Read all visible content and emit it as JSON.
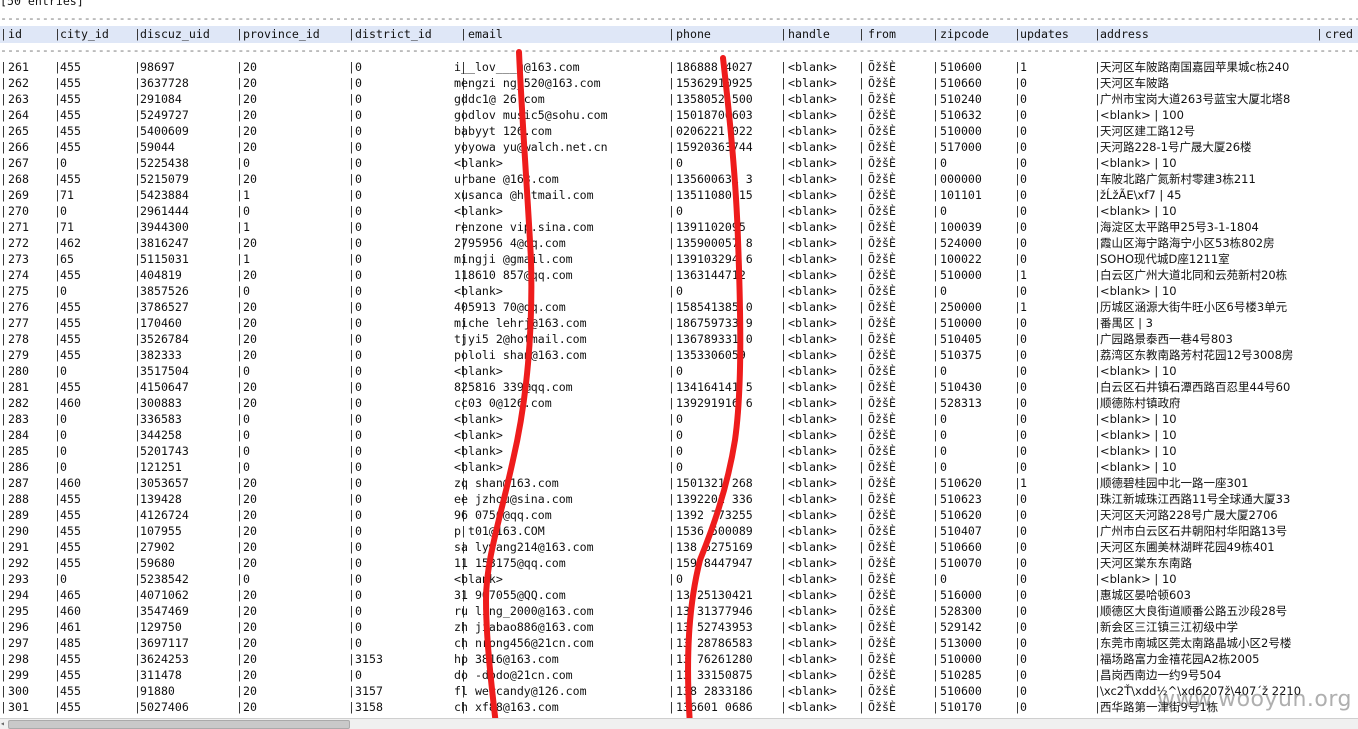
{
  "top_line": "[50 entries]",
  "columns": [
    "id",
    "city_id",
    "discuz_uid",
    "province_id",
    "district_id",
    "email",
    "phone",
    "handle",
    "from",
    "zipcode",
    "updates",
    "address",
    "cred"
  ],
  "rows": [
    [
      "261",
      "455",
      "98697",
      "20",
      "0",
      "i__lov___u@163.com",
      "186888 4027",
      "<blank>",
      "ÕžšÈ",
      "510600",
      "1",
      "天河区车陂路南国嘉园苹果城c栋240"
    ],
    [
      "262",
      "455",
      "3637728",
      "20",
      "0",
      "mengzi ng_520@163.com",
      "15362910925",
      "<blank>",
      "ÕžšÈ",
      "510660",
      "0",
      "天河区车陂路"
    ],
    [
      "263",
      "455",
      "291084",
      "20",
      "0",
      "gddc1@ 26.com",
      "1358052 500",
      "<blank>",
      "ÕžšÈ",
      "510240",
      "0",
      "广州市宝岗大道263号蓝宝大厦北塔8"
    ],
    [
      "264",
      "455",
      "5249727",
      "20",
      "0",
      "godlov music5@sohu.com",
      "15018700603",
      "<blank>",
      "ÕžšÈ",
      "510632",
      "0",
      "<blank>                     | 100"
    ],
    [
      "265",
      "455",
      "5400609",
      "20",
      "0",
      "babyyt 126.com",
      "0206221 022",
      "<blank>",
      "ÕžšÈ",
      "510000",
      "0",
      "天河区建工路12号"
    ],
    [
      "266",
      "455",
      "59044",
      "20",
      "0",
      "yoyowa  yu@walch.net.cn",
      "15920363744",
      "<blank>",
      "ÕžšÈ",
      "517000",
      "0",
      "天河路228-1号广晟大厦26楼"
    ],
    [
      "267",
      "0",
      "5225438",
      "0",
      "0",
      "<blank>",
      "0",
      "<blank>",
      "ÕžšÈ",
      "0",
      "0",
      "<blank>                     | 10"
    ],
    [
      "268",
      "455",
      "5215079",
      "20",
      "0",
      "urbane @163.com",
      "135600631 3",
      "<blank>",
      "ÕžšÈ",
      "000000",
      "0",
      "车陂北路广氮新村零建3栋211"
    ],
    [
      "269",
      "71",
      "5423884",
      "1",
      "0",
      "xusanca @hotmail.com",
      "13511080 15",
      "<blank>",
      "ÕžšÈ",
      "101101",
      "0",
      "žĹžÃE\\xf7                  | 45"
    ],
    [
      "270",
      "0",
      "2961444",
      "0",
      "0",
      "<blank>",
      "0",
      "<blank>",
      "ÕžšÈ",
      "0",
      "0",
      "<blank>                     | 10"
    ],
    [
      "271",
      "71",
      "3944300",
      "1",
      "0",
      "renzone vip.sina.com",
      "1391102095 ",
      "<blank>",
      "ÕžšÈ",
      "100039",
      "0",
      "海淀区太平路甲25号3-1-1804"
    ],
    [
      "272",
      "462",
      "3816247",
      "20",
      "0",
      "2795956 4@qq.com",
      "135900057 8",
      "<blank>",
      "ÕžšÈ",
      "524000",
      "0",
      "霞山区海宁路海宁小区53栋802房"
    ],
    [
      "273",
      "65",
      "5115031",
      "1",
      "0",
      "mingji  @gmail.com",
      "139103294 6",
      "<blank>",
      "ÕžšÈ",
      "100022",
      "0",
      "SOHO现代城D座1211室"
    ],
    [
      "274",
      "455",
      "404819",
      "20",
      "0",
      "118610 857@qq.com",
      "1363144712 ",
      "<blank>",
      "ÕžšÈ",
      "510000",
      "1",
      "白云区广州大道北同和云苑新村20栋"
    ],
    [
      "275",
      "0",
      "3857526",
      "0",
      "0",
      "<blank>",
      "0",
      "<blank>",
      "ÕžšÈ",
      "0",
      "0",
      "<blank>                     | 10"
    ],
    [
      "276",
      "455",
      "3786527",
      "20",
      "0",
      "405913 70@qq.com",
      "158541385 0",
      "<blank>",
      "ÕžšÈ",
      "250000",
      "1",
      "历城区涵源大街牛旺小区6号楼3单元"
    ],
    [
      "277",
      "455",
      "170460",
      "20",
      "0",
      "miche  lehrj@163.com",
      "186759733 9",
      "<blank>",
      "ÕžšÈ",
      "510000",
      "0",
      "番禺区                      | 3"
    ],
    [
      "278",
      "455",
      "3526784",
      "20",
      "0",
      "tjyi5 2@hotmail.com",
      "136789331 0",
      "<blank>",
      "ÕžšÈ",
      "510405",
      "0",
      "广园路景泰西一巷4号803"
    ],
    [
      "279",
      "455",
      "382333",
      "20",
      "0",
      "pololi shan@163.com",
      "1353306059 ",
      "<blank>",
      "ÕžšÈ",
      "510375",
      "0",
      "荔湾区东教南路芳村花园12号3008房"
    ],
    [
      "280",
      "0",
      "3517504",
      "0",
      "0",
      "<blank>",
      "0",
      "<blank>",
      "ÕžšÈ",
      "0",
      "0",
      "<blank>                     | 10"
    ],
    [
      "281",
      "455",
      "4150647",
      "20",
      "0",
      "825816 339@qq.com",
      "134164141 5",
      "<blank>",
      "ÕžšÈ",
      "510430",
      "0",
      "白云区石井镇石潭西路百忍里44号60"
    ],
    [
      "282",
      "460",
      "300883",
      "20",
      "0",
      "cc03 0@126.com",
      "139291916 6",
      "<blank>",
      "ÕžšÈ",
      "528313",
      "0",
      "顺德陈村镇政府"
    ],
    [
      "283",
      "0",
      "336583",
      "0",
      "0",
      "<blank>",
      "0",
      "<blank>",
      "ÕžšÈ",
      "0",
      "0",
      "<blank>                     | 10"
    ],
    [
      "284",
      "0",
      "344258",
      "0",
      "0",
      "<blank>",
      "0",
      "<blank>",
      "ÕžšÈ",
      "0",
      "0",
      "<blank>                     | 10"
    ],
    [
      "285",
      "0",
      "5201743",
      "0",
      "0",
      "<blank>",
      "0",
      "<blank>",
      "ÕžšÈ",
      "0",
      "0",
      "<blank>                     | 10"
    ],
    [
      "286",
      "0",
      "121251",
      "0",
      "0",
      "<blank>",
      "0",
      "<blank>",
      "ÕžšÈ",
      "0",
      "0",
      "<blank>                     | 10"
    ],
    [
      "287",
      "460",
      "3053657",
      "20",
      "0",
      "zq  shan@163.com",
      "1501321 268",
      "<blank>",
      "ÕžšÈ",
      "510620",
      "1",
      "顺德碧桂园中北一路一座301"
    ],
    [
      "288",
      "455",
      "139428",
      "20",
      "0",
      "ee  jzhou@sina.com",
      "1392201 336",
      "<blank>",
      "ÕžšÈ",
      "510623",
      "0",
      "珠江新城珠江西路11号全球通大厦33"
    ],
    [
      "289",
      "455",
      "4126724",
      "20",
      "0",
      "96 0756@qq.com",
      "1392 773255",
      "<blank>",
      "ÕžšÈ",
      "510620",
      "0",
      "天河区天河路228号广晟大厦2706"
    ],
    [
      "290",
      "455",
      "107955",
      "20",
      "0",
      "p  t01@163.COM",
      "1536 500089",
      "<blank>",
      "ÕžšÈ",
      "510407",
      "0",
      "广州市白云区石井朝阳村华阳路13号"
    ],
    [
      "291",
      "455",
      "27902",
      "20",
      "0",
      "sa  lywang214@163.com",
      "138 6275169",
      "<blank>",
      "ÕžšÈ",
      "510660",
      "0",
      "天河区东圃美林湖畔花园49栋401"
    ],
    [
      "292",
      "455",
      "59680",
      "20",
      "0",
      "11 153175@qq.com",
      "159 8447947",
      "<blank>",
      "ÕžšÈ",
      "510070",
      "0",
      "天河区棠东东南路"
    ],
    [
      "293",
      "0",
      "5238542",
      "0",
      "0",
      "<blank>",
      "0",
      "<blank>",
      "ÕžšÈ",
      "0",
      "0",
      "<blank>                     | 10"
    ],
    [
      "294",
      "465",
      "4071062",
      "20",
      "0",
      "31 907055@QQ.com",
      "13 25130421",
      "<blank>",
      "ÕžšÈ",
      "516000",
      "0",
      "惠城区晏哈顿603"
    ],
    [
      "295",
      "460",
      "3547469",
      "20",
      "0",
      "ru  ling_2000@163.com",
      "13 31377946",
      "<blank>",
      "ÕžšÈ",
      "528300",
      "0",
      "顺德区大良街道顺番公路五沙段28号"
    ],
    [
      "296",
      "461",
      "129750",
      "20",
      "0",
      "zh  jiabao886@163.com",
      "13 52743953",
      "<blank>",
      "ÕžšÈ",
      "529142",
      "0",
      "新会区三江镇三江初级中学"
    ],
    [
      "297",
      "485",
      "3697117",
      "20",
      "0",
      "ch  nrong456@21cn.com",
      "13 28786583",
      "<blank>",
      "ÕžšÈ",
      "513000",
      "0",
      "东莞市南城区莞太南路晶城小区2号楼"
    ],
    [
      "298",
      "455",
      "3624253",
      "20",
      "3153",
      "hp  3816@163.com",
      "13 76261280",
      "<blank>",
      "ÕžšÈ",
      "510000",
      "0",
      "福场路富力金禧花园A2栋2005"
    ],
    [
      "299",
      "455",
      "311478",
      "20",
      "0",
      "do  -dodo@21cn.com",
      "13 33150875",
      "<blank>",
      "ÕžšÈ",
      "510285",
      "0",
      "昌岗西南边一约9号504"
    ],
    [
      "300",
      "455",
      "91880",
      "20",
      "3157",
      "fl  wercandy@126.com",
      "138 2833186",
      "<blank>",
      "ÕžšÈ",
      "510600",
      "0",
      "\\xc2Ť\\xdd½^\\xd6207ž\\407´ž   2210"
    ],
    [
      "301",
      "455",
      "5027406",
      "20",
      "3158",
      "ch  xf88@163.com",
      "136601 0686",
      "<blank>",
      "ÕžšÈ",
      "510170",
      "0",
      "西华路第一津街9号1栋"
    ]
  ],
  "watermark": "www.wooyun.org",
  "accent_colors": {
    "header_bg": "#dfe7f7",
    "annotation_red": "#ee1c1c"
  }
}
